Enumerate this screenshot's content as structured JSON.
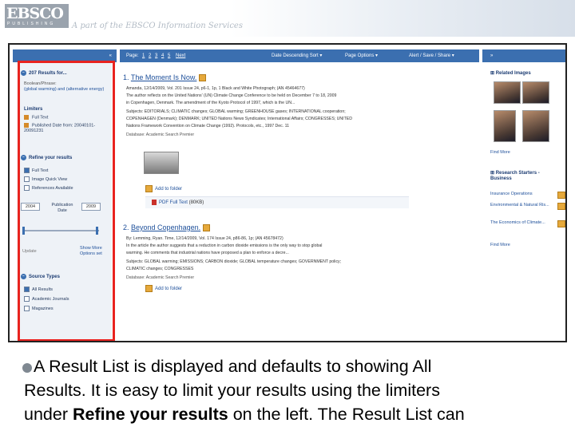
{
  "header": {
    "logo_text": "EBSCO",
    "logo_sub": "PUBLISHING",
    "tagline": "A part of the EBSCO Information Services"
  },
  "toolbar": {
    "collapse_left": "«",
    "pages_prefix": "Page:",
    "pages": [
      "1",
      "2",
      "3",
      "4",
      "5"
    ],
    "next": "Next",
    "sort": "Date Descending Sort",
    "page_options": "Page Options",
    "alert": "Alert / Save / Share",
    "expand_right": "»"
  },
  "sidebar": {
    "results_heading": "207 Results for...",
    "boolean_label": "Boolean/Phrase:",
    "query": "(global warming) and (alternative energy)",
    "limiters_heading": "Limiters",
    "limiters": [
      "Full Text",
      "Published Date from: 20040101-20091231"
    ],
    "refine_heading": "Refine your results",
    "refine_options": [
      "Full Text",
      "Image Quick View",
      "References Available"
    ],
    "year_from": "2004",
    "year_to": "2009",
    "publication_date_label": "Publication Date",
    "update_label": "Update",
    "show_more": "Show More Options set",
    "source_heading": "Source Types",
    "source_options": [
      "All Results",
      "Academic Journals",
      "Magazines"
    ]
  },
  "results": [
    {
      "number": "1.",
      "title": "The Moment Is Now.",
      "citation": "Amanda, 12/14/2009, Vol. 201 Issue 24, p6-1, 1p, 1 Black and White Photograph; (AN 45464677)",
      "abstract_1": "The author reflects on the United Nations' (UN) Climate Change Conference to be held on December 7 to 18, 2009",
      "abstract_2": "in Copenhagen, Denmark. The amendment of the Kyoto Protocol of 1997, which is the UN...",
      "subjects_1": "Subjects: EDITORIALS; CLIMATIC changes; GLOBAL warming; GREENHOUSE gases; INTERNATIONAL cooperation;",
      "subjects_2": "COPENHAGEN (Denmark); DENMARK; UNITED Nations News Syndicates; International Affairs; CONGRESSES; UNITED",
      "subjects_3": "Nations Framework Convention on Climate Change (1992). Protocols, etc., 1997 Dec. 11",
      "database": "Database: Academic Search Premier",
      "add_to_folder": "Add to folder",
      "pdf": "PDF Full Text",
      "pdf_size": "(80KB)"
    },
    {
      "number": "2.",
      "title": "Beyond Copenhagen.",
      "citation": "By: Lemming, Ryan. Time, 12/14/2009, Vol. 174 Issue 24, p86-86, 1p; (AN 45678472)",
      "abstract_1": "In the article the author suggests that a reduction in carbon dioxide emissions is the only way to stop global",
      "abstract_2": "warming. He comments that industrial nations have proposed a plan to enforce a decre...",
      "subjects_1": "Subjects: GLOBAL warming; EMISSIONS; CARBON dioxide; GLOBAL temperature changes; GOVERNMENT policy;",
      "subjects_2": "CLIMATIC changes; CONGRESSES",
      "database": "Database: Academic Search Premier",
      "add_to_folder": "Add to folder"
    }
  ],
  "right_panel": {
    "related_images": "Related Images",
    "find_more": "Find More",
    "research_starters": "Research Starters - Business",
    "starters": [
      "Insurance Operations",
      "Environmental & Natural Ris...",
      "The Economics of Climate..."
    ],
    "find_more_2": "Find More"
  },
  "caption": {
    "line1": "A Result List is displayed and defaults to showing All",
    "line2": "Results. It is easy to limit your results using the limiters",
    "line3_pre": "under ",
    "line3_bold": "Refine your results",
    "line3_post": " on the left. The Result List can"
  }
}
